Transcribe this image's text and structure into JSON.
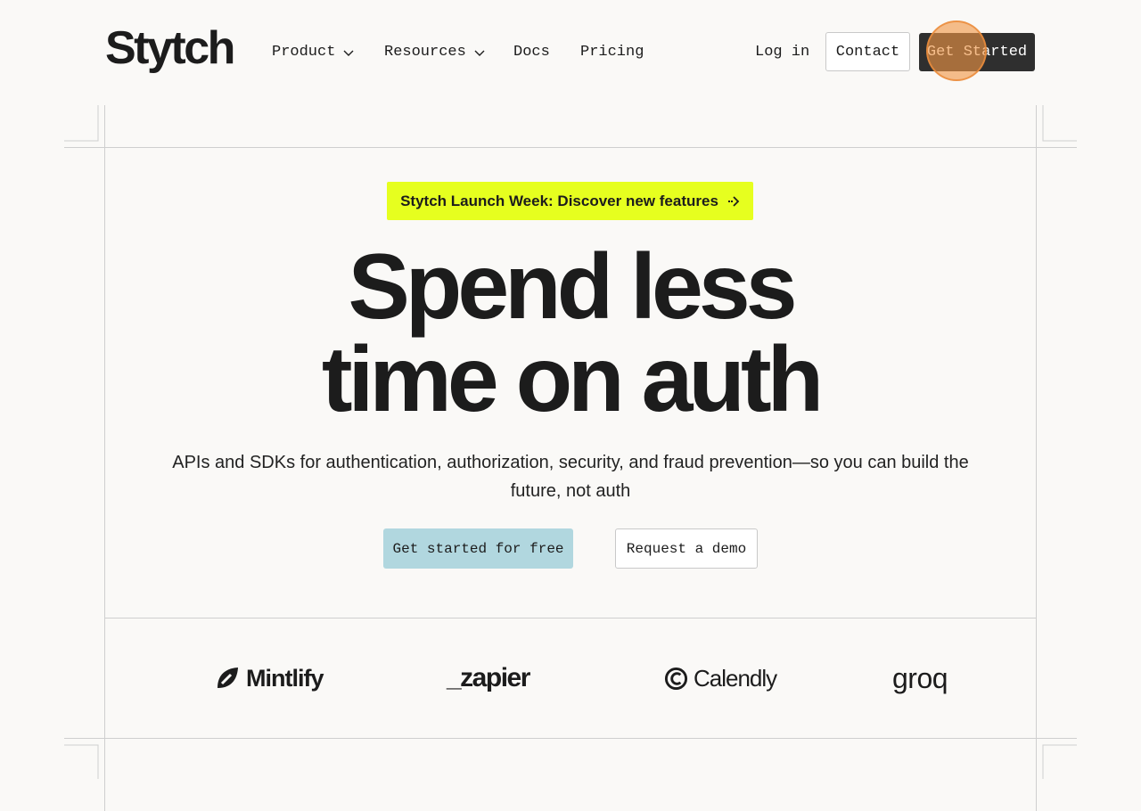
{
  "nav": {
    "brand": "Stytch",
    "items": [
      {
        "label": "Product"
      },
      {
        "label": "Resources"
      },
      {
        "label": "Docs"
      },
      {
        "label": "Pricing"
      }
    ],
    "login": "Log in",
    "contact": "Contact",
    "get_started": "Get Started"
  },
  "hero": {
    "banner": "Stytch Launch Week: Discover new features",
    "headline_line1": "Spend less",
    "headline_line2": "time on auth",
    "subtitle": "APIs and SDKs for authentication, authorization, security, and fraud prevention—so you can build the future, not auth",
    "cta_primary": "Get started for free",
    "cta_secondary": "Request a demo"
  },
  "customers": {
    "logos": [
      {
        "name": "Mintlify",
        "icon": "mintlify-leaf-icon"
      },
      {
        "name": "_zapier",
        "icon": "zapier-logo"
      },
      {
        "name": "Calendly",
        "icon": "calendly-c-icon"
      },
      {
        "name": "groq",
        "icon": "groq-logo"
      }
    ]
  },
  "colors": {
    "background": "#faf9f7",
    "banner": "#e6ff1f",
    "cta_primary": "#b1d7df",
    "dark_button": "#2f2f2f"
  }
}
